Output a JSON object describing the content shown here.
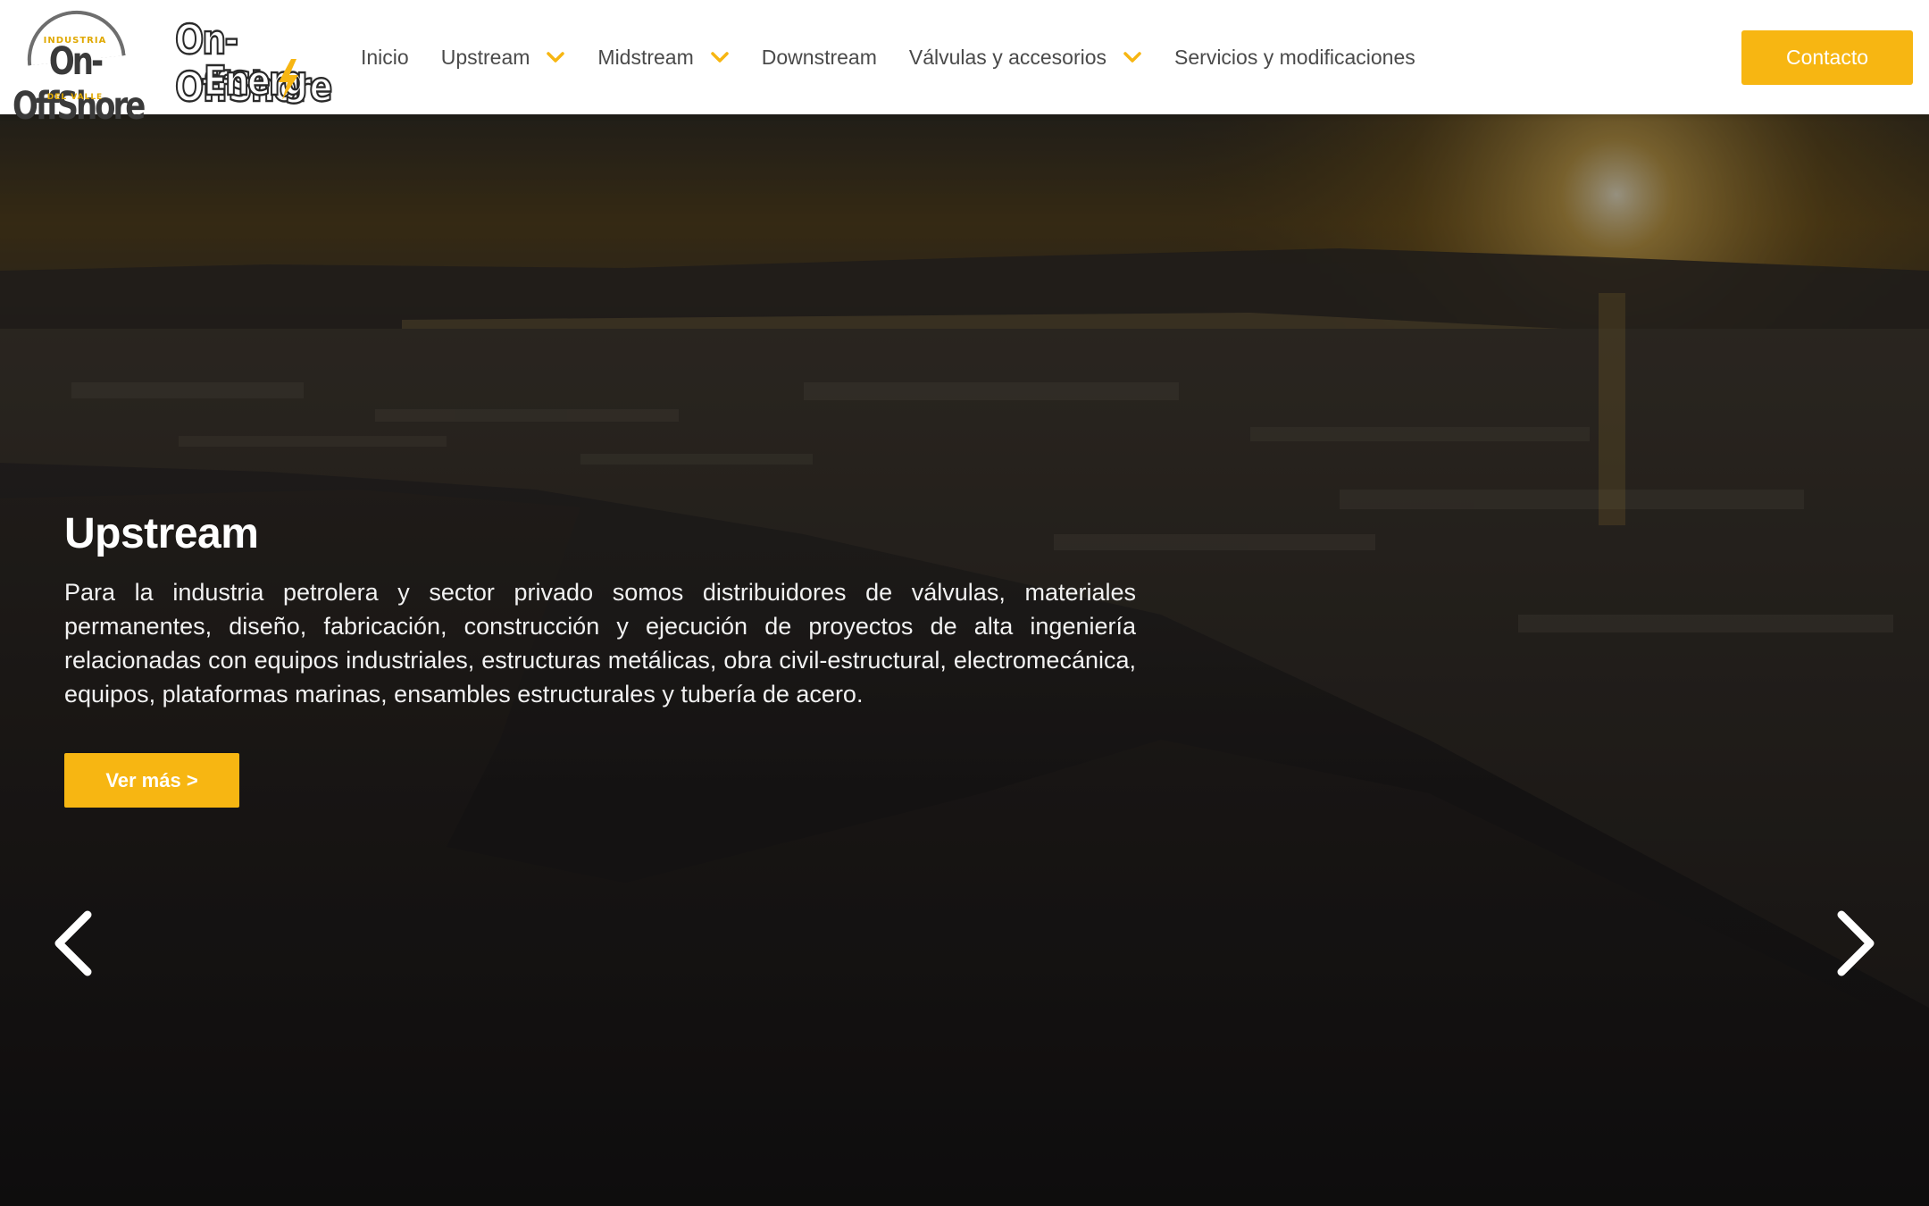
{
  "header": {
    "logo_primary": {
      "top": "INDUSTRIA",
      "main": "On-OffShore",
      "bottom": "DEL VALLE"
    },
    "logo_secondary": {
      "line1": "On-OffShore",
      "line2": "Energ"
    },
    "nav": [
      {
        "label": "Inicio",
        "has_dropdown": false
      },
      {
        "label": "Upstream",
        "has_dropdown": true
      },
      {
        "label": "Midstream",
        "has_dropdown": true
      },
      {
        "label": "Downstream",
        "has_dropdown": false
      },
      {
        "label": "Válvulas y accesorios",
        "has_dropdown": true
      },
      {
        "label": "Servicios y modificaciones",
        "has_dropdown": false
      }
    ],
    "contact_label": "Contacto"
  },
  "hero": {
    "title": "Upstream",
    "description": "Para la industria petrolera y sector privado somos distribuidores de válvulas, materiales permanentes, diseño, fabricación, construcción y ejecución de proyectos de alta ingeniería relacionadas con equipos industriales, estructuras metálicas, obra civil-estructural, electromecánica, equipos, plataformas marinas, ensambles estructurales y tubería de acero.",
    "cta_label": "Ver más >",
    "prev_icon": "chevron-left-icon",
    "next_icon": "chevron-right-icon"
  },
  "colors": {
    "accent": "#f7b612",
    "nav_text": "#4a4a4a",
    "header_bg": "#ffffff",
    "hero_text": "#ffffff"
  }
}
